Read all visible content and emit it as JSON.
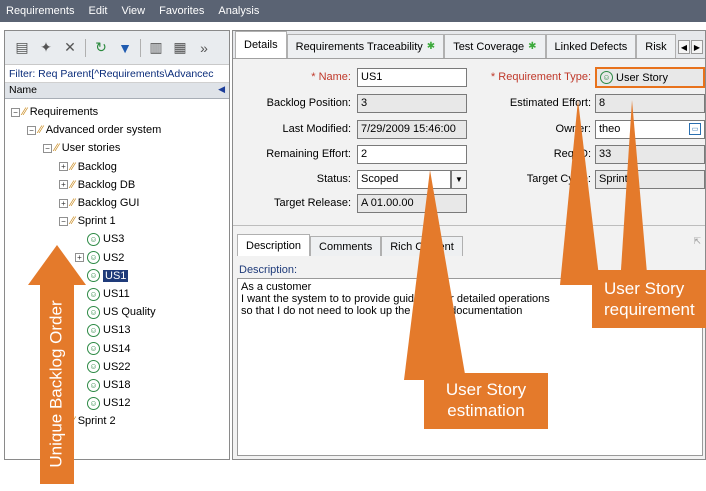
{
  "menubar": [
    "Requirements",
    "Edit",
    "View",
    "Favorites",
    "Analysis"
  ],
  "left": {
    "filter": "Filter: Req Parent[^Requirements\\Advancec",
    "column": "Name",
    "tree": [
      {
        "label": "Requirements",
        "indent": 0,
        "exp": "−",
        "icon": "req"
      },
      {
        "label": "Advanced order system",
        "indent": 1,
        "exp": "−",
        "icon": "req"
      },
      {
        "label": "User stories",
        "indent": 2,
        "exp": "−",
        "icon": "req"
      },
      {
        "label": "Backlog",
        "indent": 3,
        "exp": "+",
        "icon": "req"
      },
      {
        "label": "Backlog DB",
        "indent": 3,
        "exp": "+",
        "icon": "req"
      },
      {
        "label": "Backlog GUI",
        "indent": 3,
        "exp": "+",
        "icon": "req"
      },
      {
        "label": "Sprint 1",
        "indent": 3,
        "exp": "−",
        "icon": "req"
      },
      {
        "label": "US3",
        "indent": 4,
        "exp": "",
        "icon": "us"
      },
      {
        "label": "US2",
        "indent": 4,
        "exp": "+",
        "icon": "us"
      },
      {
        "label": "US1",
        "indent": 4,
        "exp": "",
        "icon": "us",
        "selected": true
      },
      {
        "label": "US11",
        "indent": 4,
        "exp": "",
        "icon": "us"
      },
      {
        "label": "US Quality",
        "indent": 4,
        "exp": "",
        "icon": "us"
      },
      {
        "label": "US13",
        "indent": 4,
        "exp": "",
        "icon": "us"
      },
      {
        "label": "US14",
        "indent": 4,
        "exp": "",
        "icon": "us"
      },
      {
        "label": "US22",
        "indent": 4,
        "exp": "",
        "icon": "us"
      },
      {
        "label": "US18",
        "indent": 4,
        "exp": "",
        "icon": "us"
      },
      {
        "label": "US12",
        "indent": 4,
        "exp": "",
        "icon": "us"
      },
      {
        "label": "Sprint 2",
        "indent": 3,
        "exp": "",
        "icon": "req"
      }
    ]
  },
  "tabs": [
    {
      "label": "Details",
      "star": false,
      "active": true
    },
    {
      "label": "Requirements Traceability",
      "star": true
    },
    {
      "label": "Test Coverage",
      "star": true
    },
    {
      "label": "Linked Defects",
      "star": false
    },
    {
      "label": "Risk",
      "star": false
    }
  ],
  "fields": {
    "name_label": "* Name:",
    "name_value": "US1",
    "reqtype_label": "* Requirement Type:",
    "reqtype_value": "User Story",
    "backlog_label": "Backlog Position:",
    "backlog_value": "3",
    "effort_label": "Estimated Effort:",
    "effort_value": "8",
    "modified_label": "Last Modified:",
    "modified_value": "7/29/2009 15:46:00",
    "owner_label": "Owner:",
    "owner_value": "theo",
    "remaining_label": "Remaining Effort:",
    "remaining_value": "2",
    "reqid_label": "Req ID:",
    "reqid_value": "33",
    "status_label": "Status:",
    "status_value": "Scoped",
    "targetcycle_label": "Target Cycle:",
    "targetcycle_value": "Sprint 1",
    "release_label": "Target Release:",
    "release_value": "A 01.00.00"
  },
  "subtabs": [
    "Description",
    "Comments",
    "Rich Content"
  ],
  "description": {
    "label": "Description:",
    "lines": [
      "As a customer",
      "I want the system to to provide guidance for detailed operations",
      "so that I do not need to look up the printed documentation"
    ]
  },
  "callouts": {
    "backlog": "Unique Backlog Order",
    "estimation": [
      "User Story",
      "estimation"
    ],
    "requirement": [
      "User Story",
      "requirement"
    ]
  },
  "colors": {
    "callout": "#e47a2b",
    "menubar": "#5a6373",
    "selection": "#1f3b7a"
  }
}
